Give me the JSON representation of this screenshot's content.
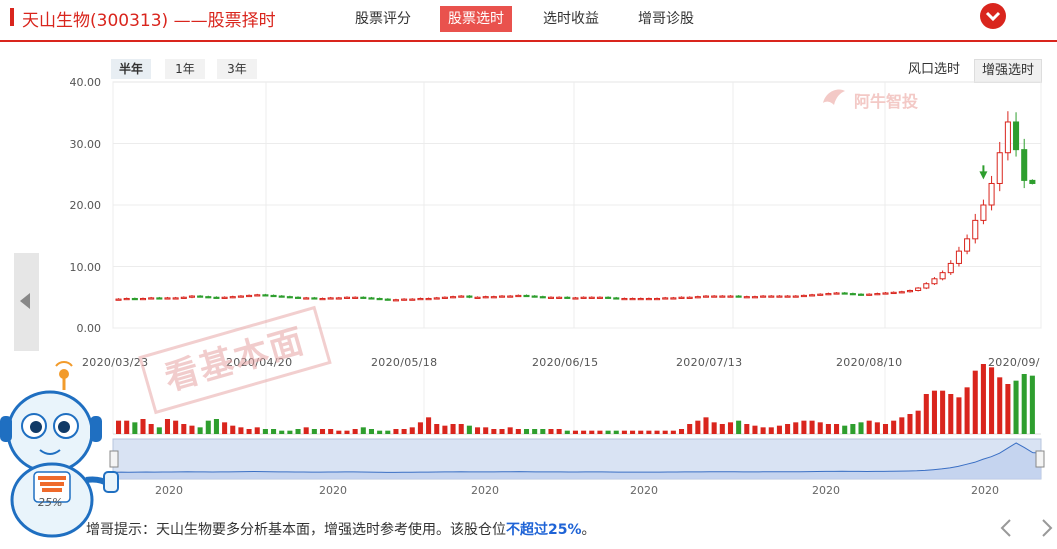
{
  "header": {
    "title": "天山生物(300313) ——股票择时",
    "tabs": [
      "股票评分",
      "股票选时",
      "选时收益",
      "增哥诊股"
    ],
    "active_tab": 1
  },
  "periods": [
    "半年",
    "1年",
    "3年"
  ],
  "active_period": 0,
  "modes": [
    "风口选时",
    "增强选时"
  ],
  "watermark": "阿牛智投",
  "stamp": "看基本面",
  "mascot": {
    "badge": "25%"
  },
  "tip": {
    "prefix": "增哥提示：天山生物要多分析基本面，增强选时参考使用。该股仓位",
    "highlight": "不超过25%",
    "suffix": "。"
  },
  "colors": {
    "up": "#d9251d",
    "down": "#2e9e2e",
    "accent": "#d9251d"
  },
  "chart_data": {
    "type": "candlestick",
    "y_ticks": [
      "40.00",
      "30.00",
      "20.00",
      "10.00",
      "0.00"
    ],
    "ylim": [
      0,
      40
    ],
    "date_labels": [
      "2020/03/23",
      "2020/04/20",
      "2020/05/18",
      "2020/06/15",
      "2020/07/13",
      "2020/08/10",
      "2020/09/"
    ],
    "navigator_labels": [
      "2020",
      "2020",
      "2020",
      "2020",
      "2020",
      "2020"
    ],
    "close": [
      4.7,
      4.8,
      4.7,
      4.8,
      4.9,
      4.8,
      4.9,
      4.9,
      5.0,
      5.2,
      5.1,
      5.0,
      4.9,
      5.0,
      5.1,
      5.2,
      5.3,
      5.4,
      5.3,
      5.2,
      5.1,
      5.0,
      4.9,
      4.9,
      4.8,
      4.8,
      4.9,
      4.9,
      5.0,
      5.0,
      4.9,
      4.8,
      4.7,
      4.6,
      4.6,
      4.7,
      4.7,
      4.8,
      4.8,
      4.9,
      5.0,
      5.1,
      5.2,
      5.0,
      5.0,
      5.1,
      5.1,
      5.2,
      5.2,
      5.3,
      5.2,
      5.1,
      5.0,
      5.0,
      5.0,
      4.9,
      4.9,
      5.0,
      5.0,
      5.0,
      4.9,
      4.8,
      4.8,
      4.8,
      4.8,
      4.8,
      4.8,
      4.9,
      4.9,
      5.0,
      5.0,
      5.1,
      5.2,
      5.2,
      5.2,
      5.2,
      5.1,
      5.1,
      5.1,
      5.2,
      5.2,
      5.2,
      5.2,
      5.2,
      5.3,
      5.4,
      5.5,
      5.6,
      5.7,
      5.6,
      5.5,
      5.4,
      5.5,
      5.6,
      5.7,
      5.8,
      5.9,
      6.1,
      6.5,
      7.2,
      8.0,
      9.0,
      10.5,
      12.5,
      14.5,
      17.5,
      20.0,
      23.5,
      28.5,
      33.5,
      29.0,
      24.0,
      23.5
    ],
    "volume": [
      8,
      8,
      7,
      9,
      6,
      4,
      9,
      8,
      6,
      5,
      4,
      8,
      9,
      7,
      5,
      4,
      3,
      4,
      3,
      3,
      2,
      2,
      3,
      4,
      3,
      3,
      3,
      2,
      2,
      3,
      4,
      3,
      2,
      2,
      3,
      3,
      4,
      7,
      10,
      6,
      5,
      6,
      6,
      5,
      4,
      4,
      3,
      3,
      4,
      3,
      3,
      3,
      3,
      3,
      3,
      2,
      2,
      2,
      2,
      2,
      2,
      2,
      2,
      2,
      2,
      2,
      2,
      2,
      2,
      3,
      6,
      8,
      10,
      7,
      6,
      7,
      8,
      6,
      5,
      4,
      4,
      5,
      6,
      7,
      8,
      8,
      7,
      6,
      6,
      5,
      6,
      7,
      8,
      7,
      6,
      8,
      10,
      12,
      14,
      24,
      26,
      26,
      24,
      22,
      28,
      38,
      42,
      40,
      34,
      30,
      32,
      36,
      35
    ]
  }
}
